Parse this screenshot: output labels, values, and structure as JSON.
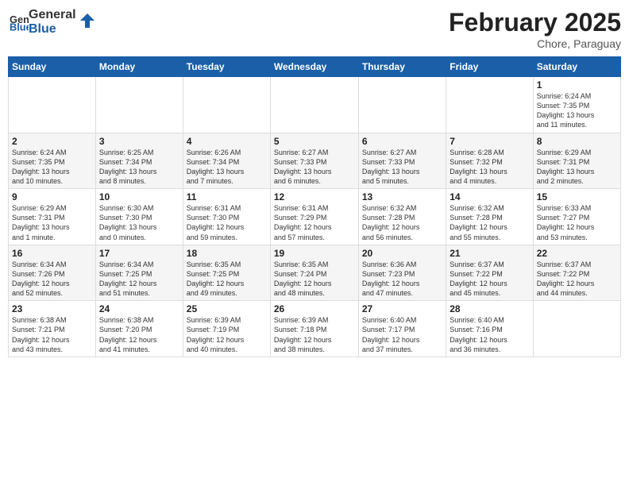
{
  "header": {
    "logo_general": "General",
    "logo_blue": "Blue",
    "title": "February 2025",
    "subtitle": "Chore, Paraguay"
  },
  "days_of_week": [
    "Sunday",
    "Monday",
    "Tuesday",
    "Wednesday",
    "Thursday",
    "Friday",
    "Saturday"
  ],
  "weeks": [
    [
      {
        "day": "",
        "info": ""
      },
      {
        "day": "",
        "info": ""
      },
      {
        "day": "",
        "info": ""
      },
      {
        "day": "",
        "info": ""
      },
      {
        "day": "",
        "info": ""
      },
      {
        "day": "",
        "info": ""
      },
      {
        "day": "1",
        "info": "Sunrise: 6:24 AM\nSunset: 7:35 PM\nDaylight: 13 hours\nand 11 minutes."
      }
    ],
    [
      {
        "day": "2",
        "info": "Sunrise: 6:24 AM\nSunset: 7:35 PM\nDaylight: 13 hours\nand 10 minutes."
      },
      {
        "day": "3",
        "info": "Sunrise: 6:25 AM\nSunset: 7:34 PM\nDaylight: 13 hours\nand 8 minutes."
      },
      {
        "day": "4",
        "info": "Sunrise: 6:26 AM\nSunset: 7:34 PM\nDaylight: 13 hours\nand 7 minutes."
      },
      {
        "day": "5",
        "info": "Sunrise: 6:27 AM\nSunset: 7:33 PM\nDaylight: 13 hours\nand 6 minutes."
      },
      {
        "day": "6",
        "info": "Sunrise: 6:27 AM\nSunset: 7:33 PM\nDaylight: 13 hours\nand 5 minutes."
      },
      {
        "day": "7",
        "info": "Sunrise: 6:28 AM\nSunset: 7:32 PM\nDaylight: 13 hours\nand 4 minutes."
      },
      {
        "day": "8",
        "info": "Sunrise: 6:29 AM\nSunset: 7:31 PM\nDaylight: 13 hours\nand 2 minutes."
      }
    ],
    [
      {
        "day": "9",
        "info": "Sunrise: 6:29 AM\nSunset: 7:31 PM\nDaylight: 13 hours\nand 1 minute."
      },
      {
        "day": "10",
        "info": "Sunrise: 6:30 AM\nSunset: 7:30 PM\nDaylight: 13 hours\nand 0 minutes."
      },
      {
        "day": "11",
        "info": "Sunrise: 6:31 AM\nSunset: 7:30 PM\nDaylight: 12 hours\nand 59 minutes."
      },
      {
        "day": "12",
        "info": "Sunrise: 6:31 AM\nSunset: 7:29 PM\nDaylight: 12 hours\nand 57 minutes."
      },
      {
        "day": "13",
        "info": "Sunrise: 6:32 AM\nSunset: 7:28 PM\nDaylight: 12 hours\nand 56 minutes."
      },
      {
        "day": "14",
        "info": "Sunrise: 6:32 AM\nSunset: 7:28 PM\nDaylight: 12 hours\nand 55 minutes."
      },
      {
        "day": "15",
        "info": "Sunrise: 6:33 AM\nSunset: 7:27 PM\nDaylight: 12 hours\nand 53 minutes."
      }
    ],
    [
      {
        "day": "16",
        "info": "Sunrise: 6:34 AM\nSunset: 7:26 PM\nDaylight: 12 hours\nand 52 minutes."
      },
      {
        "day": "17",
        "info": "Sunrise: 6:34 AM\nSunset: 7:25 PM\nDaylight: 12 hours\nand 51 minutes."
      },
      {
        "day": "18",
        "info": "Sunrise: 6:35 AM\nSunset: 7:25 PM\nDaylight: 12 hours\nand 49 minutes."
      },
      {
        "day": "19",
        "info": "Sunrise: 6:35 AM\nSunset: 7:24 PM\nDaylight: 12 hours\nand 48 minutes."
      },
      {
        "day": "20",
        "info": "Sunrise: 6:36 AM\nSunset: 7:23 PM\nDaylight: 12 hours\nand 47 minutes."
      },
      {
        "day": "21",
        "info": "Sunrise: 6:37 AM\nSunset: 7:22 PM\nDaylight: 12 hours\nand 45 minutes."
      },
      {
        "day": "22",
        "info": "Sunrise: 6:37 AM\nSunset: 7:22 PM\nDaylight: 12 hours\nand 44 minutes."
      }
    ],
    [
      {
        "day": "23",
        "info": "Sunrise: 6:38 AM\nSunset: 7:21 PM\nDaylight: 12 hours\nand 43 minutes."
      },
      {
        "day": "24",
        "info": "Sunrise: 6:38 AM\nSunset: 7:20 PM\nDaylight: 12 hours\nand 41 minutes."
      },
      {
        "day": "25",
        "info": "Sunrise: 6:39 AM\nSunset: 7:19 PM\nDaylight: 12 hours\nand 40 minutes."
      },
      {
        "day": "26",
        "info": "Sunrise: 6:39 AM\nSunset: 7:18 PM\nDaylight: 12 hours\nand 38 minutes."
      },
      {
        "day": "27",
        "info": "Sunrise: 6:40 AM\nSunset: 7:17 PM\nDaylight: 12 hours\nand 37 minutes."
      },
      {
        "day": "28",
        "info": "Sunrise: 6:40 AM\nSunset: 7:16 PM\nDaylight: 12 hours\nand 36 minutes."
      },
      {
        "day": "",
        "info": ""
      }
    ]
  ]
}
